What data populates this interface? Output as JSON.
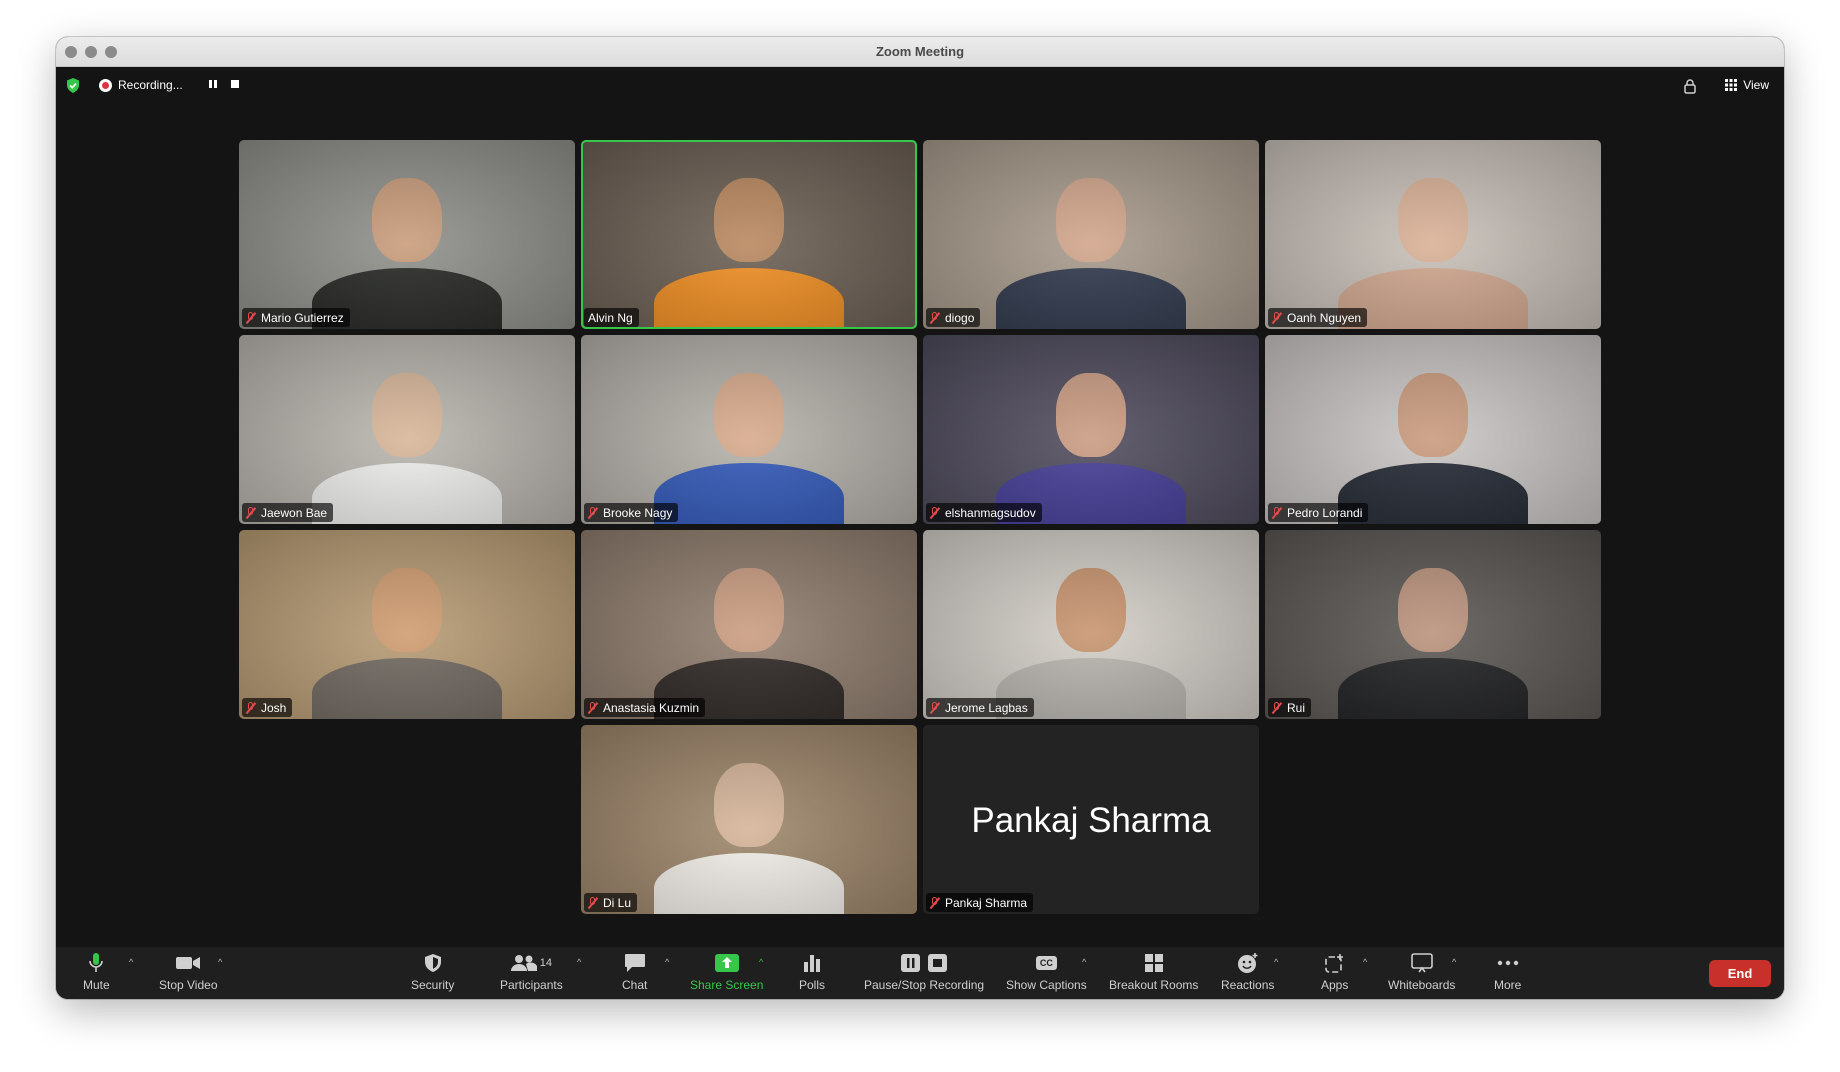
{
  "window": {
    "title": "Zoom Meeting"
  },
  "topbar": {
    "recording_label": "Recording...",
    "view_label": "View"
  },
  "participants": [
    {
      "name": "Mario Gutierrez",
      "muted": true,
      "bg": "#8f8f8a",
      "skin": "#c89a78",
      "shirt": "#222421",
      "active": false
    },
    {
      "name": "Alvin Ng",
      "muted": false,
      "bg": "#6a5e52",
      "skin": "#b8865c",
      "shirt": "#f08c1e",
      "active": true
    },
    {
      "name": "diogo",
      "muted": true,
      "bg": "#a79a8b",
      "skin": "#d1a489",
      "shirt": "#2c3549",
      "active": false
    },
    {
      "name": "Oanh Nguyen",
      "muted": true,
      "bg": "#c8c0b8",
      "skin": "#d9b095",
      "shirt": "#cfa58c",
      "active": false
    },
    {
      "name": "Jaewon Bae",
      "muted": true,
      "bg": "#b9b5ae",
      "skin": "#d7b597",
      "shirt": "#eeeeec",
      "active": false
    },
    {
      "name": "Brooke Nagy",
      "muted": true,
      "bg": "#b5b1aa",
      "skin": "#d7a98a",
      "shirt": "#2f56b8",
      "active": false
    },
    {
      "name": "elshanmagsudov",
      "muted": true,
      "bg": "#4e4a5c",
      "skin": "#c99a80",
      "shirt": "#413a95",
      "active": false
    },
    {
      "name": "Pedro Lorandi",
      "muted": true,
      "bg": "#c9c6c4",
      "skin": "#c99a7c",
      "shirt": "#1f2530",
      "active": false
    },
    {
      "name": "Josh",
      "muted": true,
      "bg": "#b79b73",
      "skin": "#cf9b6e",
      "shirt": "#6e665e",
      "active": false
    },
    {
      "name": "Anastasia Kuzmin",
      "muted": true,
      "bg": "#8f7c6d",
      "skin": "#c99b7e",
      "shirt": "#2b2421",
      "active": false
    },
    {
      "name": "Jerome Lagbas",
      "muted": true,
      "bg": "#d3cec7",
      "skin": "#c7936d",
      "shirt": "#b6b3ad",
      "active": false
    },
    {
      "name": "Rui",
      "muted": true,
      "bg": "#5a5652",
      "skin": "#b9917a",
      "shirt": "#1c1d1f",
      "active": false
    },
    {
      "name": "Di Lu",
      "muted": true,
      "bg": "#9d8569",
      "skin": "#d5b397",
      "shirt": "#f2efe8",
      "active": false
    },
    {
      "name": "Pankaj Sharma",
      "muted": true,
      "video_off": true,
      "active": false
    }
  ],
  "toolbar": {
    "mute": "Mute",
    "stop_video": "Stop Video",
    "security": "Security",
    "participants": "Participants",
    "participants_count": "14",
    "chat": "Chat",
    "share_screen": "Share Screen",
    "polls": "Polls",
    "pause_stop_recording": "Pause/Stop Recording",
    "show_captions": "Show Captions",
    "captions_badge": "CC",
    "breakout_rooms": "Breakout Rooms",
    "reactions": "Reactions",
    "apps": "Apps",
    "whiteboards": "Whiteboards",
    "more": "More",
    "end": "End"
  },
  "colors": {
    "accent_green": "#35c64a",
    "end_red": "#c8312b",
    "muted_red": "#e24b4b"
  }
}
